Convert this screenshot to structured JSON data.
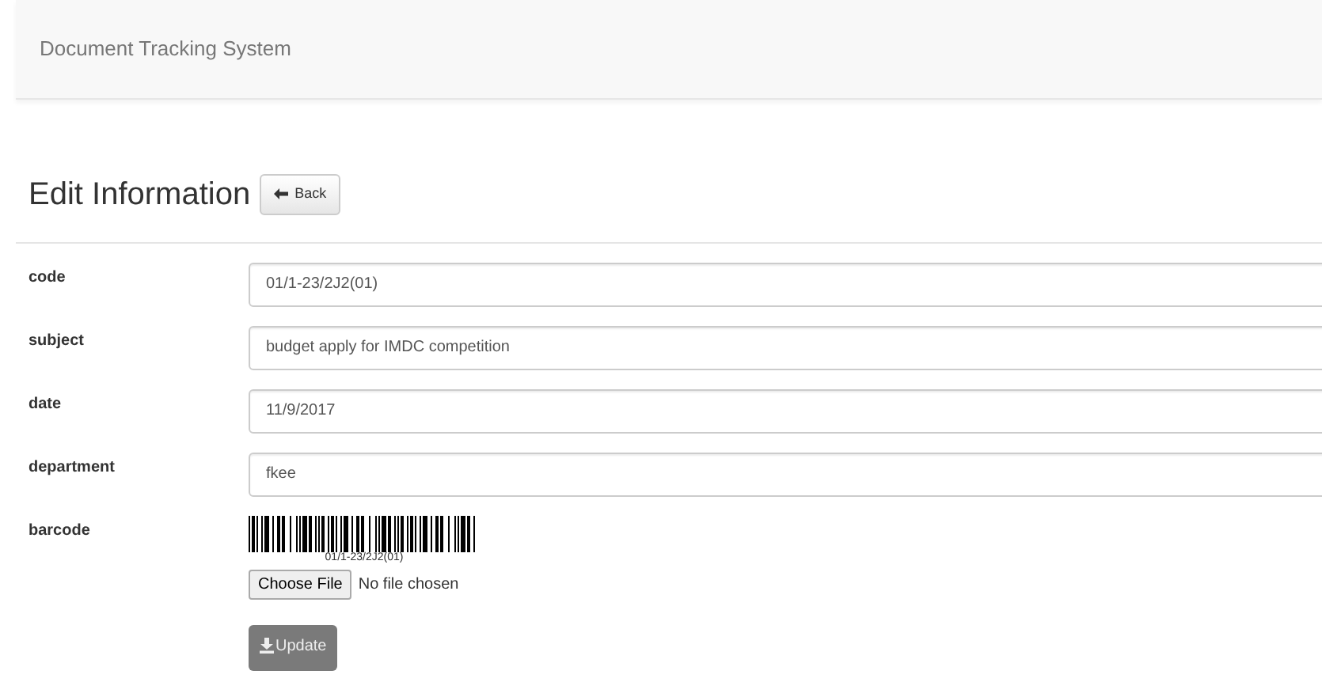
{
  "navbar": {
    "brand": "Document Tracking System"
  },
  "heading": {
    "title": "Edit Information",
    "back_button": "Back"
  },
  "fields": [
    {
      "kind": "text",
      "label": "code",
      "value": "01/1-23/2J2(01)"
    },
    {
      "kind": "text",
      "label": "subject",
      "value": "budget apply for IMDC competition"
    },
    {
      "kind": "text",
      "label": "date",
      "value": "11/9/2017"
    },
    {
      "kind": "text",
      "label": "department",
      "value": "fkee"
    },
    {
      "kind": "barcode",
      "label": "barcode",
      "caption": "01/1-23/2J2(01)",
      "file_button": "Choose File",
      "file_status": "No file chosen"
    }
  ],
  "submit_button": "Update"
}
